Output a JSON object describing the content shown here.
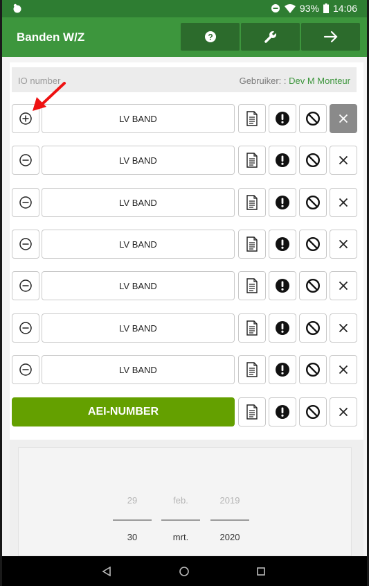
{
  "status_bar": {
    "battery": "93%",
    "time": "14:06"
  },
  "app_bar": {
    "title": "Banden W/Z",
    "buttons": [
      {
        "icon": "help-icon"
      },
      {
        "icon": "wrench-icon"
      },
      {
        "icon": "arrow-right-icon"
      }
    ]
  },
  "info": {
    "io_placeholder": "IO number",
    "user_label": "Gebruiker: :",
    "user_name": "Dev M Monteur"
  },
  "rows": [
    {
      "toggle": "plus-circle-icon",
      "label": "LV BAND"
    },
    {
      "toggle": "minus-circle-icon",
      "label": "LV BAND"
    },
    {
      "toggle": "minus-circle-icon",
      "label": "LV BAND"
    },
    {
      "toggle": "minus-circle-icon",
      "label": "LV BAND"
    },
    {
      "toggle": "minus-circle-icon",
      "label": "LV BAND"
    },
    {
      "toggle": "minus-circle-icon",
      "label": "LV BAND"
    },
    {
      "toggle": "minus-circle-icon",
      "label": "LV BAND"
    }
  ],
  "aei_button": "AEI-NUMBER",
  "date_picker": {
    "previous": {
      "day": "29",
      "month": "feb.",
      "year": "2019"
    },
    "selected": {
      "day": "30",
      "month": "mrt.",
      "year": "2020"
    }
  },
  "colors": {
    "status_bar": "#2e7d32",
    "app_bar": "#3d963d",
    "app_bar_button": "#2c6b2c",
    "aei_button": "#64a000",
    "user_name": "#3d963d"
  }
}
